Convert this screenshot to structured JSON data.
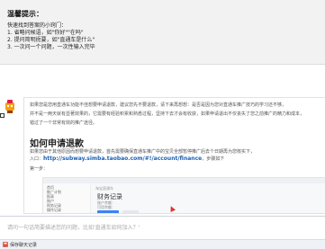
{
  "tips": {
    "title": "温馨提示：",
    "lines": [
      "快速找到答案的小窍门：",
      "1. 省略问候语，如\"你好\"\"在吗\"",
      "2. 提问简明扼要，如\"直通车是什么\"",
      "3. 一次问一个问题，一次性输入完毕"
    ]
  },
  "answer": {
    "para1": "如果您是您用直通车功能不佳想要申请退款，建议您先不要退款，请下来再想想：是否是因为您对直通车推广技巧的学习还不够，",
    "para2": "并不是一两天就有显著效果的，它需要有经验积累和熟悉过程，坚持下去才会有收获，如果申请退出不仅丧失了您之前推广的精力和成本，",
    "para3": "错过了一个非常有效的推广途径。",
    "heading": "如何申请退款",
    "link_prefix": "如果您由于其他原因而想要申请退款，首先需要确保直通车推广中的宝贝全部暂停推广后去个日期再为您核实下，",
    "link_intro": "入口：",
    "url": "http://subway.simba.taobao.com/#!/account/finance",
    "link_suffix": "，步骤如下",
    "step": "第一步："
  },
  "screenshot": {
    "logo": "淘宝直通车",
    "title": "财务记录",
    "side_items": [
      "首页",
      "推广计划",
      "报表",
      "账户",
      "财务记录",
      "操作记录"
    ],
    "rows": [
      "账户余额：",
      "可用余额：",
      "冻结金额："
    ]
  },
  "input": {
    "placeholder": "请问一句话简要描述您的问题，比如'直通车如何加入？'"
  },
  "footer": {
    "label": "保存聊天记录"
  }
}
